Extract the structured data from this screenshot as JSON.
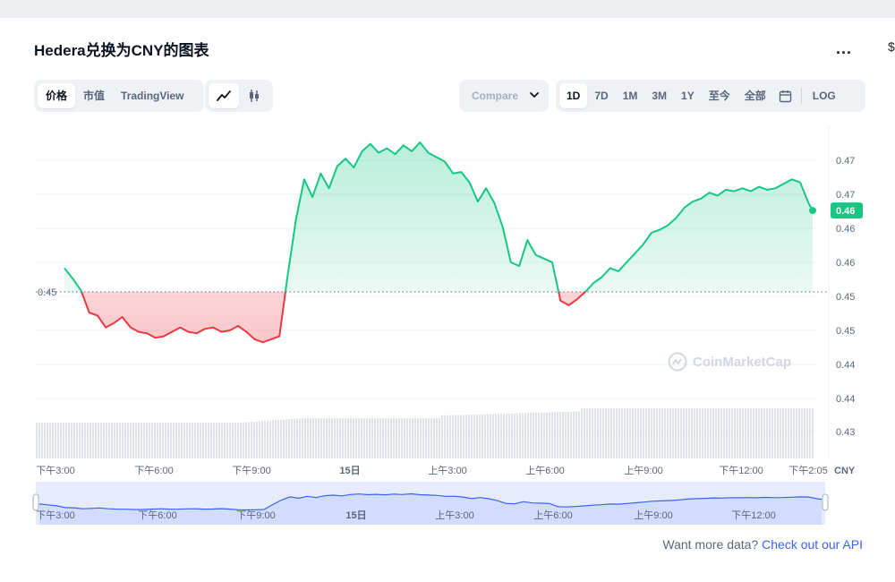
{
  "header": {
    "title": "Hedera兑换为CNY的图表",
    "more_label": "..."
  },
  "view_tabs": [
    {
      "label": "价格",
      "active": true
    },
    {
      "label": "市值",
      "active": false
    },
    {
      "label": "TradingView",
      "active": false
    }
  ],
  "chart_type_icons": [
    {
      "icon": "line-chart-icon",
      "active": true
    },
    {
      "icon": "candlestick-icon",
      "active": false
    }
  ],
  "compare": {
    "label": "Compare"
  },
  "range_tabs": [
    {
      "label": "1D",
      "active": true
    },
    {
      "label": "7D",
      "active": false
    },
    {
      "label": "1M",
      "active": false
    },
    {
      "label": "3M",
      "active": false
    },
    {
      "label": "1Y",
      "active": false
    },
    {
      "label": "至今",
      "active": false
    },
    {
      "label": "全部",
      "active": false
    }
  ],
  "log_label": "LOG",
  "colors": {
    "up": "#16c784",
    "down": "#ea3943",
    "navigator": "#3861fb",
    "current_badge": "#16c784"
  },
  "watermark": "CoinMarketCap",
  "footer": {
    "text": "Want more data?",
    "link": "Check out our API"
  },
  "chart_data": {
    "type": "line",
    "y_currency": "CNY",
    "y_ticks": [
      "0.47",
      "0.47",
      "0.46",
      "0.46",
      "0.45",
      "0.45",
      "0.44",
      "0.44",
      "0.43"
    ],
    "x_ticks": [
      "下午3:00",
      "下午6:00",
      "下午9:00",
      "15日",
      "上午3:00",
      "上午6:00",
      "上午9:00",
      "下午12:00",
      "下午2:05"
    ],
    "navigator_ticks": [
      "下午3:00",
      "下午6:00",
      "下午9:00",
      "15日",
      "上午3:00",
      "上午6:00",
      "上午9:00",
      "下午12:00"
    ],
    "reference_price": 0.45,
    "reference_label": "0.45",
    "current_price_label": "0.46",
    "ylim": [
      0.4275,
      0.4725
    ],
    "series_points": [
      [
        0,
        0.4532
      ],
      [
        2,
        0.4518
      ],
      [
        4,
        0.4502
      ],
      [
        6,
        0.4472
      ],
      [
        8,
        0.4468
      ],
      [
        10,
        0.4452
      ],
      [
        12,
        0.4458
      ],
      [
        14,
        0.4466
      ],
      [
        16,
        0.4452
      ],
      [
        18,
        0.4446
      ],
      [
        20,
        0.4444
      ],
      [
        22,
        0.4438
      ],
      [
        24,
        0.444
      ],
      [
        26,
        0.4446
      ],
      [
        28,
        0.4452
      ],
      [
        30,
        0.4446
      ],
      [
        32,
        0.4444
      ],
      [
        34,
        0.445
      ],
      [
        36,
        0.4452
      ],
      [
        38,
        0.4446
      ],
      [
        40,
        0.4448
      ],
      [
        42,
        0.4454
      ],
      [
        44,
        0.4446
      ],
      [
        46,
        0.4436
      ],
      [
        48,
        0.4432
      ],
      [
        50,
        0.4436
      ],
      [
        52,
        0.444
      ],
      [
        54,
        0.4522
      ],
      [
        56,
        0.4598
      ],
      [
        58,
        0.4652
      ],
      [
        60,
        0.4628
      ],
      [
        62,
        0.466
      ],
      [
        64,
        0.464
      ],
      [
        66,
        0.467
      ],
      [
        68,
        0.468
      ],
      [
        70,
        0.4668
      ],
      [
        72,
        0.469
      ],
      [
        74,
        0.47
      ],
      [
        76,
        0.4688
      ],
      [
        78,
        0.4694
      ],
      [
        80,
        0.4686
      ],
      [
        82,
        0.4698
      ],
      [
        84,
        0.469
      ],
      [
        86,
        0.4702
      ],
      [
        88,
        0.4688
      ],
      [
        90,
        0.4682
      ],
      [
        92,
        0.4676
      ],
      [
        94,
        0.466
      ],
      [
        96,
        0.4662
      ],
      [
        98,
        0.4648
      ],
      [
        100,
        0.4622
      ],
      [
        102,
        0.464
      ],
      [
        104,
        0.462
      ],
      [
        106,
        0.4588
      ],
      [
        108,
        0.454
      ],
      [
        110,
        0.4535
      ],
      [
        112,
        0.457
      ],
      [
        114,
        0.455
      ],
      [
        116,
        0.4545
      ],
      [
        118,
        0.454
      ],
      [
        120,
        0.4488
      ],
      [
        122,
        0.4482
      ],
      [
        124,
        0.449
      ],
      [
        126,
        0.45
      ],
      [
        128,
        0.4512
      ],
      [
        130,
        0.452
      ],
      [
        132,
        0.4532
      ],
      [
        134,
        0.4528
      ],
      [
        136,
        0.454
      ],
      [
        138,
        0.4552
      ],
      [
        140,
        0.4564
      ],
      [
        142,
        0.458
      ],
      [
        144,
        0.4584
      ],
      [
        146,
        0.459
      ],
      [
        148,
        0.46
      ],
      [
        150,
        0.4614
      ],
      [
        152,
        0.4622
      ],
      [
        154,
        0.4626
      ],
      [
        156,
        0.4634
      ],
      [
        158,
        0.463
      ],
      [
        160,
        0.4638
      ],
      [
        162,
        0.4636
      ],
      [
        164,
        0.464
      ],
      [
        166,
        0.4636
      ],
      [
        168,
        0.4642
      ],
      [
        170,
        0.4638
      ],
      [
        172,
        0.464
      ],
      [
        174,
        0.4646
      ],
      [
        176,
        0.4652
      ],
      [
        178,
        0.4648
      ],
      [
        180,
        0.462
      ],
      [
        181,
        0.461
      ]
    ]
  }
}
